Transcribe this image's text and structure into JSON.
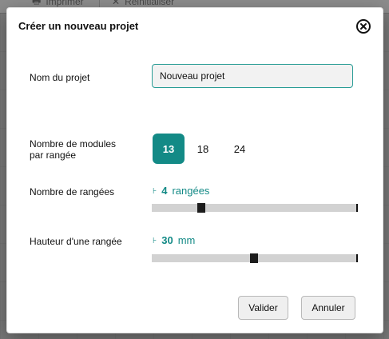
{
  "background": {
    "toolbar": {
      "print_label": "Imprimer",
      "reset_label": "Réinitialiser"
    }
  },
  "dialog": {
    "title": "Créer un nouveau projet",
    "close_icon": "close-icon",
    "fields": {
      "project_name": {
        "label": "Nom du projet",
        "value": "Nouveau projet"
      },
      "modules_per_row": {
        "label_line1": "Nombre de modules",
        "label_line2": "par rangée",
        "options": [
          "13",
          "18",
          "24"
        ],
        "selected": "13"
      },
      "row_count": {
        "label": "Nombre de rangées",
        "prefix": "⊦",
        "value": "4",
        "unit": "rangées",
        "slider_fraction": 0.23
      },
      "row_height": {
        "label": "Hauteur d'une rangée",
        "prefix": "⊦",
        "value": "30",
        "unit": "mm",
        "slider_fraction": 0.5
      }
    },
    "buttons": {
      "validate": "Valider",
      "cancel": "Annuler"
    }
  },
  "colors": {
    "accent": "#138a86",
    "input_border": "#2a9d96"
  }
}
